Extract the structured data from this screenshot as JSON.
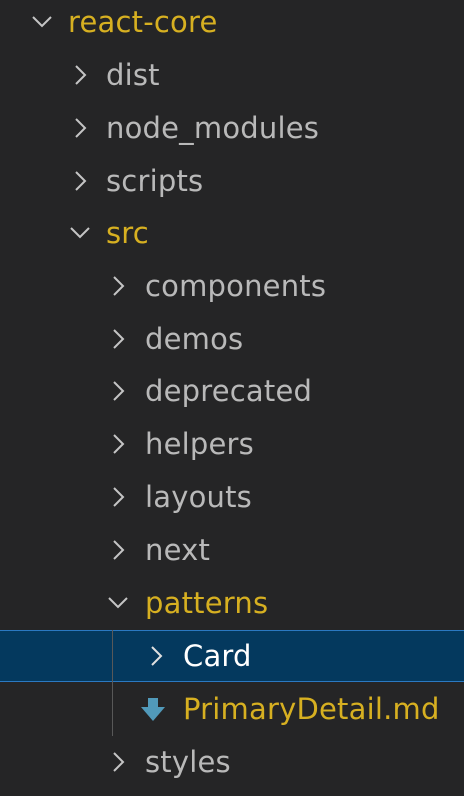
{
  "explorer": {
    "root": {
      "label": "react-core",
      "state": "expanded",
      "icon": "chevron-down-icon"
    },
    "items": [
      {
        "label": "dist",
        "state": "collapsed",
        "icon": "chevron-right-icon"
      },
      {
        "label": "node_modules",
        "state": "collapsed",
        "icon": "chevron-right-icon"
      },
      {
        "label": "scripts",
        "state": "collapsed",
        "icon": "chevron-right-icon"
      },
      {
        "label": "src",
        "state": "expanded",
        "icon": "chevron-down-icon"
      }
    ],
    "src_children": [
      {
        "label": "components",
        "state": "collapsed",
        "icon": "chevron-right-icon"
      },
      {
        "label": "demos",
        "state": "collapsed",
        "icon": "chevron-right-icon"
      },
      {
        "label": "deprecated",
        "state": "collapsed",
        "icon": "chevron-right-icon"
      },
      {
        "label": "helpers",
        "state": "collapsed",
        "icon": "chevron-right-icon"
      },
      {
        "label": "layouts",
        "state": "collapsed",
        "icon": "chevron-right-icon"
      },
      {
        "label": "next",
        "state": "collapsed",
        "icon": "chevron-right-icon"
      },
      {
        "label": "patterns",
        "state": "expanded",
        "icon": "chevron-down-icon"
      },
      {
        "label": "styles",
        "state": "collapsed",
        "icon": "chevron-right-icon"
      }
    ],
    "patterns_children": [
      {
        "label": "Card",
        "state": "collapsed",
        "selected": true,
        "icon": "chevron-right-icon"
      },
      {
        "label": "PrimaryDetail.md",
        "type": "file",
        "icon": "markdown-download-icon"
      }
    ]
  },
  "colors": {
    "background": "#252526",
    "text": "#b9b9b9",
    "modified": "#d7b021",
    "selection_bg": "#04395e",
    "selection_border": "#2b79c2",
    "file_icon": "#519aba"
  }
}
